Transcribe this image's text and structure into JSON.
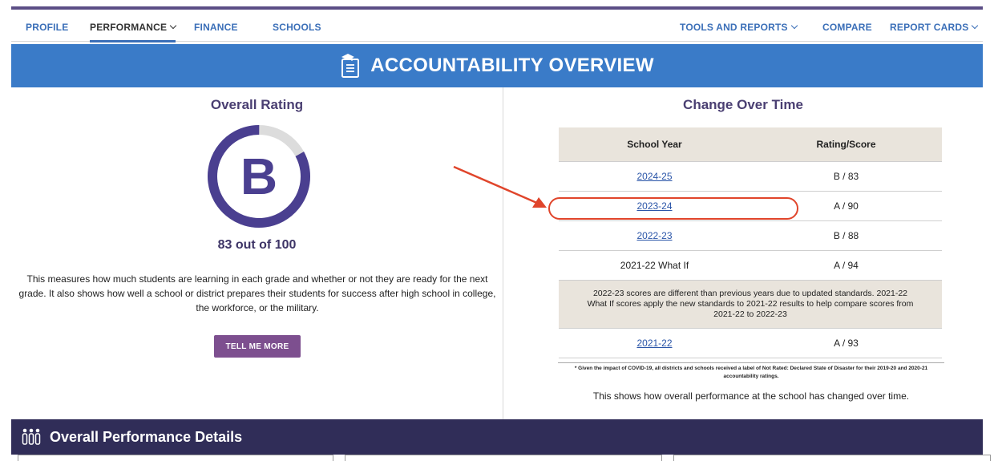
{
  "nav": {
    "left": [
      {
        "label": "PROFILE"
      },
      {
        "label": "PERFORMANCE"
      },
      {
        "label": "FINANCE"
      },
      {
        "label": "SCHOOLS"
      }
    ],
    "right": [
      {
        "label": "TOOLS AND REPORTS"
      },
      {
        "label": "COMPARE"
      },
      {
        "label": "REPORT CARDS"
      }
    ]
  },
  "banner": {
    "title": "ACCOUNTABILITY OVERVIEW",
    "icon": "clipboard-grad-cap-icon"
  },
  "overall": {
    "heading": "Overall Rating",
    "grade": "B",
    "score": 83,
    "score_text": "83 out of 100",
    "description": "This measures how much students are learning in each grade and whether or not they are ready for the next grade. It also shows how well a school or district prepares their students for success after high school in college, the workforce, or the military.",
    "button": "TELL ME MORE"
  },
  "change": {
    "heading": "Change Over Time",
    "columns": [
      "School Year",
      "Rating/Score"
    ],
    "rows": [
      {
        "year": "2024-25",
        "rating": "B / 83"
      },
      {
        "year": "2023-24",
        "rating": "A / 90"
      },
      {
        "year": "2022-23",
        "rating": "B / 88"
      },
      {
        "year": "2021-22 What If",
        "rating": "A / 94"
      }
    ],
    "note": "2022-23 scores are different than previous years due to updated standards. 2021-22 What If scores apply the new standards to 2021-22 results to help compare scores from 2021-22 to 2022-23",
    "last_row": {
      "year": "2021-22",
      "rating": "A / 93"
    },
    "footnote": "* Given the impact of COVID-19, all districts and schools received a label of Not Rated: Declared State of Disaster for their 2019-20 and 2020-21 accountability ratings.",
    "description": "This shows how overall performance at the school has changed over time."
  },
  "details": {
    "title": "Overall Performance Details",
    "icon": "people-group-icon"
  },
  "colors": {
    "nav_link": "#3b6fb8",
    "banner": "#3a7bc8",
    "heading": "#4a3f72",
    "ring": "#4a3f90",
    "button": "#7d4f8f",
    "details_bar": "#302d58",
    "annotation": "#e0452b"
  }
}
